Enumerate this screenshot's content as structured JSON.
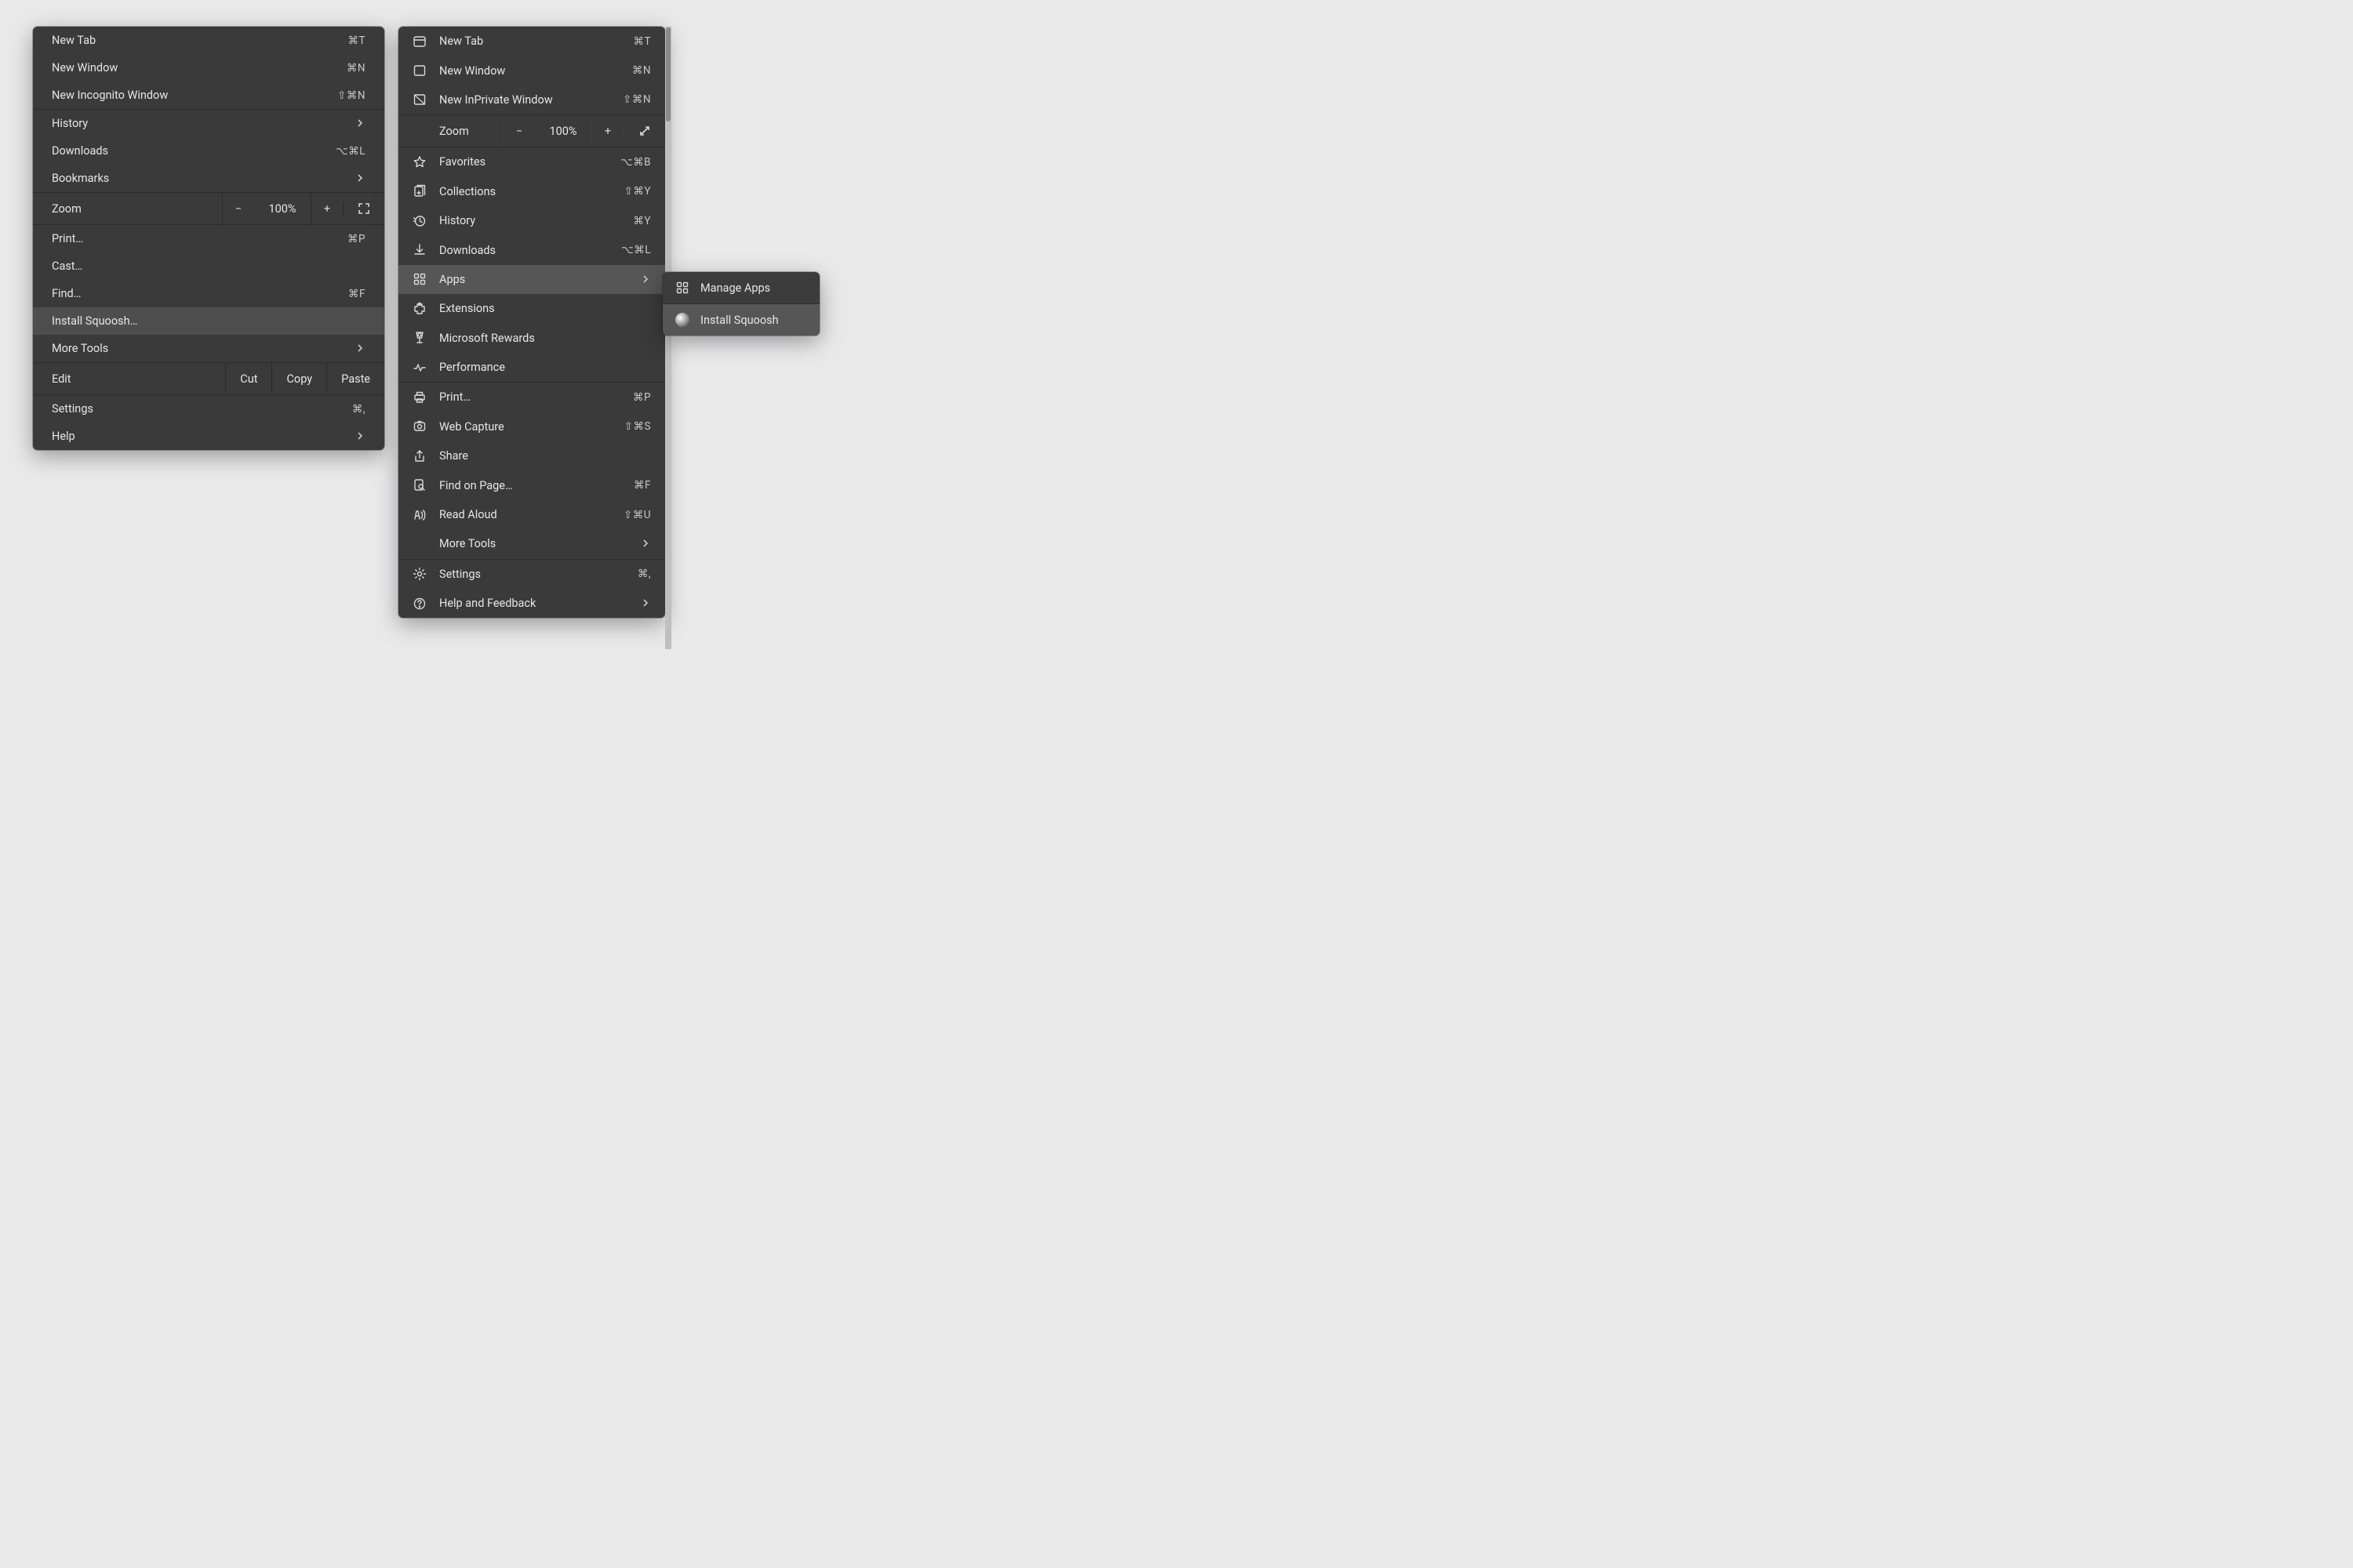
{
  "chrome": {
    "new_tab": {
      "label": "New Tab",
      "shortcut": "⌘T"
    },
    "new_window": {
      "label": "New Window",
      "shortcut": "⌘N"
    },
    "new_incognito": {
      "label": "New Incognito Window",
      "shortcut": "⇧⌘N"
    },
    "history": {
      "label": "History"
    },
    "downloads": {
      "label": "Downloads",
      "shortcut": "⌥⌘L"
    },
    "bookmarks": {
      "label": "Bookmarks"
    },
    "zoom": {
      "label": "Zoom",
      "value": "100%",
      "minus": "−",
      "plus": "+"
    },
    "print": {
      "label": "Print…",
      "shortcut": "⌘P"
    },
    "cast": {
      "label": "Cast…"
    },
    "find": {
      "label": "Find…",
      "shortcut": "⌘F"
    },
    "install": {
      "label": "Install Squoosh…"
    },
    "more_tools": {
      "label": "More Tools"
    },
    "edit": {
      "label": "Edit",
      "cut": "Cut",
      "copy": "Copy",
      "paste": "Paste"
    },
    "settings": {
      "label": "Settings",
      "shortcut": "⌘,"
    },
    "help": {
      "label": "Help"
    }
  },
  "edge": {
    "new_tab": {
      "label": "New Tab",
      "shortcut": "⌘T"
    },
    "new_window": {
      "label": "New Window",
      "shortcut": "⌘N"
    },
    "new_inprivate": {
      "label": "New InPrivate Window",
      "shortcut": "⇧⌘N"
    },
    "zoom": {
      "label": "Zoom",
      "value": "100%",
      "minus": "−",
      "plus": "+"
    },
    "favorites": {
      "label": "Favorites",
      "shortcut": "⌥⌘B"
    },
    "collections": {
      "label": "Collections",
      "shortcut": "⇧⌘Y"
    },
    "history": {
      "label": "History",
      "shortcut": "⌘Y"
    },
    "downloads": {
      "label": "Downloads",
      "shortcut": "⌥⌘L"
    },
    "apps": {
      "label": "Apps"
    },
    "extensions": {
      "label": "Extensions"
    },
    "rewards": {
      "label": "Microsoft Rewards"
    },
    "performance": {
      "label": "Performance"
    },
    "print": {
      "label": "Print…",
      "shortcut": "⌘P"
    },
    "web_capture": {
      "label": "Web Capture",
      "shortcut": "⇧⌘S"
    },
    "share": {
      "label": "Share"
    },
    "find": {
      "label": "Find on Page…",
      "shortcut": "⌘F"
    },
    "read_aloud": {
      "label": "Read Aloud",
      "shortcut": "⇧⌘U"
    },
    "more_tools": {
      "label": "More Tools"
    },
    "settings": {
      "label": "Settings",
      "shortcut": "⌘,"
    },
    "help": {
      "label": "Help and Feedback"
    }
  },
  "submenu": {
    "manage": {
      "label": "Manage Apps"
    },
    "install": {
      "label": "Install Squoosh"
    }
  }
}
